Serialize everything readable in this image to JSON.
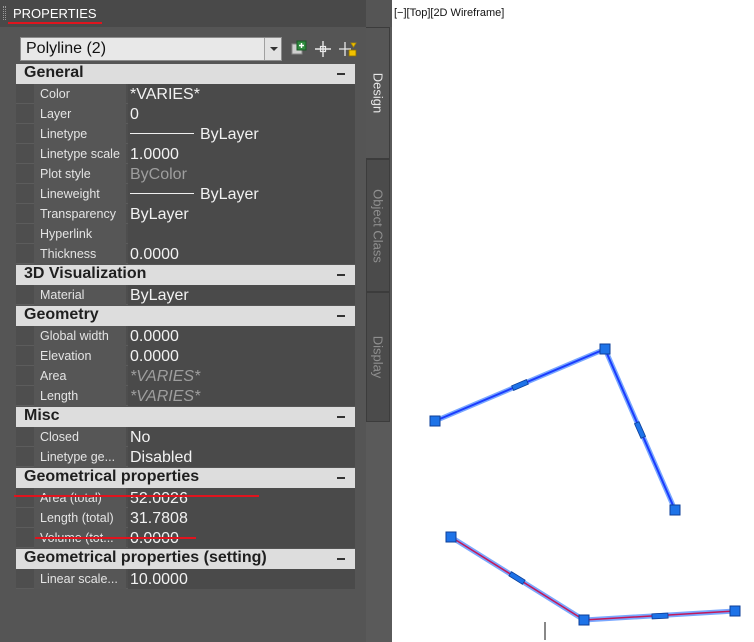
{
  "palette": {
    "title": "PROPERTIES",
    "selector": {
      "value": "Polyline (2)"
    },
    "toolbar": [
      {
        "name": "toggle-pickadd-icon"
      },
      {
        "name": "select-objects-icon"
      },
      {
        "name": "quick-select-icon"
      }
    ],
    "sections": [
      {
        "title": "General",
        "rows": [
          {
            "label": "Color",
            "value": "*VARIES*"
          },
          {
            "label": "Layer",
            "value": "0"
          },
          {
            "label": "Linetype",
            "value": "ByLayer",
            "line": true
          },
          {
            "label": "Linetype scale",
            "value": "1.0000"
          },
          {
            "label": "Plot style",
            "value": "ByColor",
            "style": "dim2"
          },
          {
            "label": "Lineweight",
            "value": "ByLayer",
            "line": true
          },
          {
            "label": "Transparency",
            "value": "ByLayer"
          },
          {
            "label": "Hyperlink",
            "value": ""
          },
          {
            "label": "Thickness",
            "value": "0.0000"
          }
        ]
      },
      {
        "title": "3D Visualization",
        "rows": [
          {
            "label": "Material",
            "value": "ByLayer"
          }
        ]
      },
      {
        "title": "Geometry",
        "rows": [
          {
            "label": "Global width",
            "value": "0.0000"
          },
          {
            "label": "Elevation",
            "value": "0.0000"
          },
          {
            "label": "Area",
            "value": "*VARIES*",
            "style": "dim"
          },
          {
            "label": "Length",
            "value": "*VARIES*",
            "style": "dim"
          }
        ]
      },
      {
        "title": "Misc",
        "rows": [
          {
            "label": "Closed",
            "value": "No"
          },
          {
            "label": "Linetype ge...",
            "value": "Disabled"
          }
        ]
      },
      {
        "title": "Geometrical properties",
        "rows": [
          {
            "label": "Area (total)",
            "value": "52.0026"
          },
          {
            "label": "Length (total)",
            "value": "31.7808"
          },
          {
            "label": "Volume (tot...",
            "value": "0.0000"
          }
        ]
      },
      {
        "title": "Geometrical properties (setting)",
        "rows": [
          {
            "label": "Linear scale...",
            "value": "10.0000"
          }
        ]
      }
    ],
    "tabs": [
      "Design",
      "Object Class",
      "Display"
    ],
    "active_tab": "Design"
  },
  "viewport": {
    "label": "[−][Top][2D Wireframe]",
    "colors": {
      "polyline_1": "#1a3cff",
      "polyline_2": "#c2185b",
      "grip": "#1e73e8",
      "highlight": "#7aa8ff"
    }
  },
  "colors": {
    "annotation_underline": "#e0141e",
    "palette_bg": "#555555",
    "section_header_bg": "#dddddd"
  }
}
